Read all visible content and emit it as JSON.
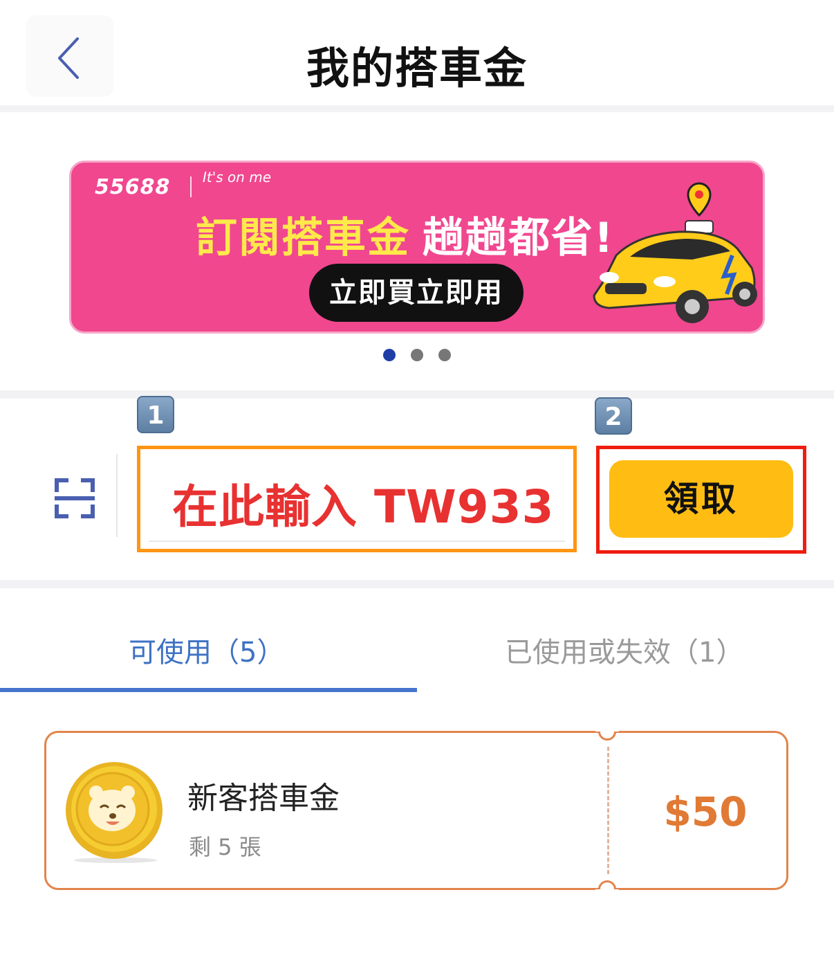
{
  "header": {
    "title": "我的搭車金",
    "back_icon": "chevron-left-icon"
  },
  "banner": {
    "brand": "55688",
    "slogan": "It's on me",
    "headline_highlight": "訂閱搭車金",
    "headline_rest": "趟趟都省!",
    "cta_label": "立即買立即用",
    "background_color": "#f0478f",
    "page_count": 3,
    "active_page": 1
  },
  "redeem": {
    "scan_icon": "scan-icon",
    "code_input_value": "在此輸入 TW933",
    "claim_label": "領取",
    "step1_badge": "1",
    "step2_badge": "2",
    "claim_color": "#ffbd13"
  },
  "tabs": [
    {
      "label": "可使用（5）",
      "active": true
    },
    {
      "label": "已使用或失效（1）",
      "active": false
    }
  ],
  "coupons": [
    {
      "name": "新客搭車金",
      "remaining": "剩 5 張",
      "amount": "$50",
      "icon": "bear-coin-icon"
    }
  ],
  "colors": {
    "accent_blue": "#3e72c4",
    "coupon_orange": "#e07a34"
  }
}
